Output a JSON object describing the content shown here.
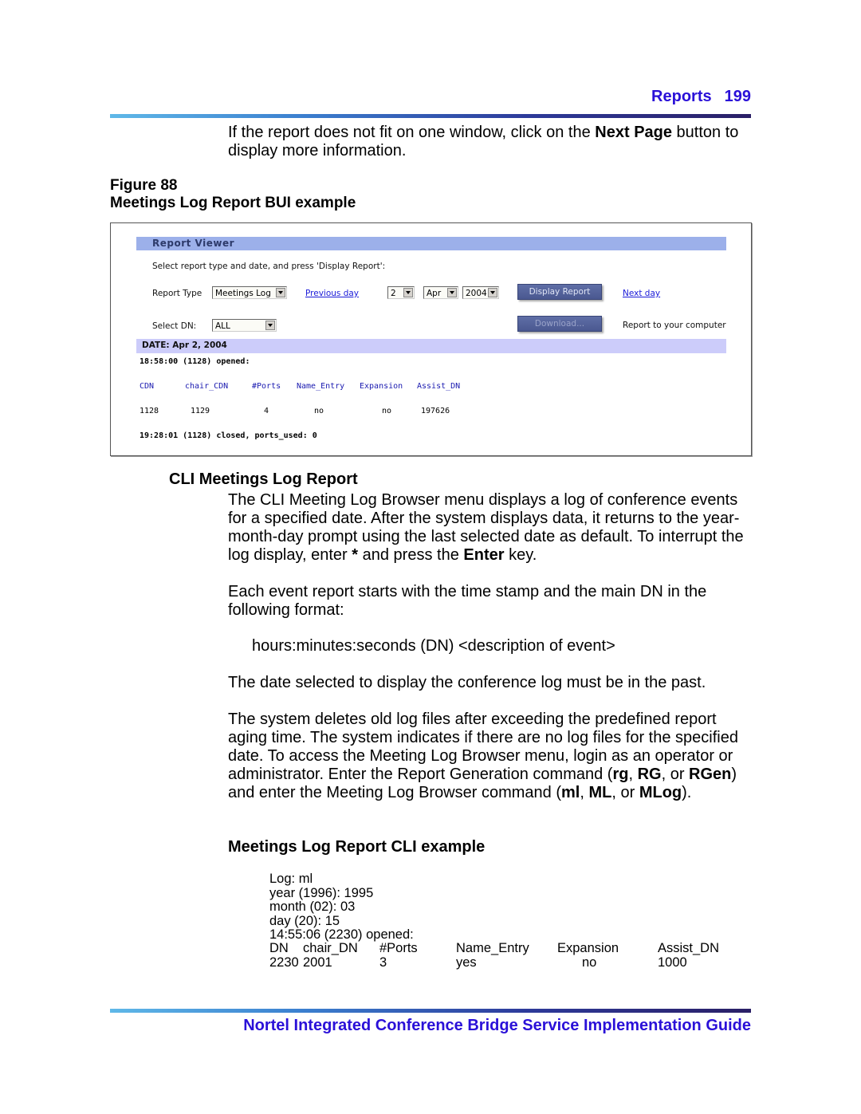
{
  "header": {
    "section": "Reports",
    "page_number": "199"
  },
  "intro": {
    "before": "If the report does not fit on one window, click on the ",
    "bold": "Next Page",
    "after": " button to display more information."
  },
  "figure": {
    "number": "Figure 88",
    "caption": "Meetings Log Report BUI example",
    "report_viewer": {
      "title": "Report Viewer",
      "instruction": "Select report type and date, and press 'Display Report':",
      "report_type_label": "Report Type",
      "report_type_value": "Meetings Log",
      "previous_day": "Previous day",
      "day_value": "2",
      "month_value": "Apr",
      "year_value": "2004",
      "display_report_button": "Display Report",
      "next_day": "Next day",
      "select_dn_label": "Select DN:",
      "select_dn_value": "ALL",
      "download_button": "Download...",
      "download_note": "Report to your computer",
      "date_header": "DATE: Apr 2, 2004",
      "opened_line": "18:58:00 (1128) opened:",
      "columns": [
        "CDN",
        "chair_CDN",
        "#Ports",
        "Name_Entry",
        "Expansion",
        "Assist_DN"
      ],
      "row": [
        "1128",
        "1129",
        "4",
        "no",
        "no",
        "197626"
      ],
      "closed_line": "19:28:01 (1128) closed, ports_used: 0"
    }
  },
  "cli_section": {
    "heading": "CLI Meetings Log Report",
    "p1": {
      "before": "The CLI Meeting Log Browser menu displays a log of conference events for a specified date. After the system displays data, it returns to the year-month-day prompt using the last selected date as default. To interrupt the log display, enter ",
      "star": "*",
      "middle": " and press the ",
      "enter": "Enter",
      "after": " key."
    },
    "p2": "Each event report starts with the time stamp and the main DN in the following format:",
    "format": "hours:minutes:seconds (DN) <description of event>",
    "p3": "The date selected to display the conference log must be in the past.",
    "p4": {
      "t1": "The system deletes old log files after exceeding the predefined report aging time. The system indicates if there are no log files for the specified date. To access the Meeting Log Browser menu, login as an operator or administrator. Enter the Report Generation command (",
      "b1": "rg",
      "t2": ", ",
      "b2": "RG",
      "t3": ", or ",
      "b3": "RGen",
      "t4": ") and enter the Meeting Log Browser command (",
      "b4": "ml",
      "t5": ", ",
      "b5": "ML",
      "t6": ", or ",
      "b6": "MLog",
      "t7": ")."
    }
  },
  "cli_example": {
    "heading": "Meetings Log Report CLI example",
    "lines": [
      "Log: ml",
      "year (1996): 1995",
      "month (02): 03",
      "day (20): 15",
      "14:55:06 (2230) opened:"
    ],
    "columns": [
      "DN",
      "chair_DN",
      "#Ports",
      "Name_Entry",
      "Expansion",
      "Assist_DN"
    ],
    "row": [
      "2230",
      "2001",
      "3",
      "yes",
      "no",
      "1000"
    ]
  },
  "footer": {
    "title": "Nortel Integrated Conference Bridge Service Implementation Guide"
  },
  "colors": {
    "heading_blue": "#2a10d8",
    "link_blue": "#1a1ad8",
    "viewer_bar": "#9cb0ea",
    "date_bar": "#ccccfa"
  }
}
